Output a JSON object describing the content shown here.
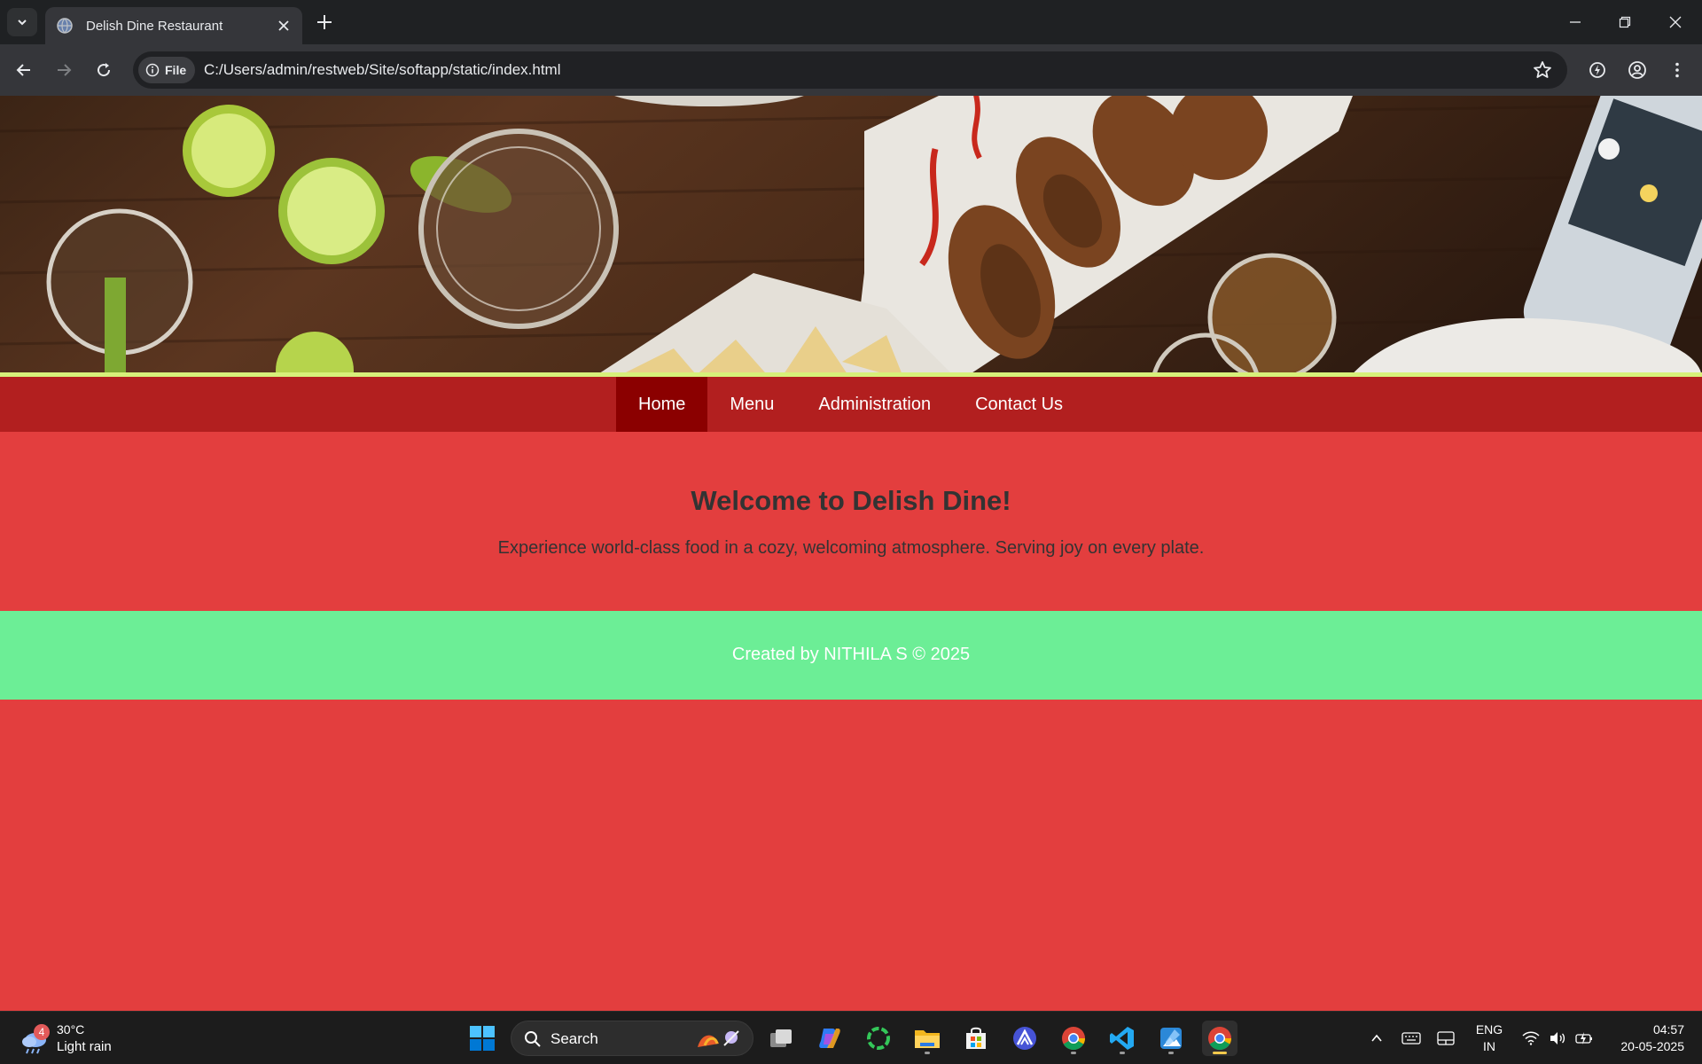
{
  "browser": {
    "tab_title": "Delish Dine Restaurant",
    "address_chip": "File",
    "url": "C:/Users/admin/restweb/Site/softapp/static/index.html"
  },
  "site": {
    "nav": [
      {
        "label": "Home",
        "active": true
      },
      {
        "label": "Menu",
        "active": false
      },
      {
        "label": "Administration",
        "active": false
      },
      {
        "label": "Contact Us",
        "active": false
      }
    ],
    "welcome_title": "Welcome to Delish Dine!",
    "tagline": "Experience world-class food in a cozy, welcoming atmosphere. Serving joy on every plate.",
    "footer": "Created by NITHILA S © 2025"
  },
  "taskbar": {
    "weather_temp": "30°C",
    "weather_condition": "Light rain",
    "weather_badge": "4",
    "search_label": "Search",
    "language_line1": "ENG",
    "language_line2": "IN",
    "time": "04:57",
    "date": "20-05-2025"
  },
  "colors": {
    "page_background": "#e33e3e",
    "navbar": "#b21f1f",
    "nav_active": "#8b0000",
    "footer": "#6cee96",
    "accent_stripe": "#d7f07a"
  }
}
